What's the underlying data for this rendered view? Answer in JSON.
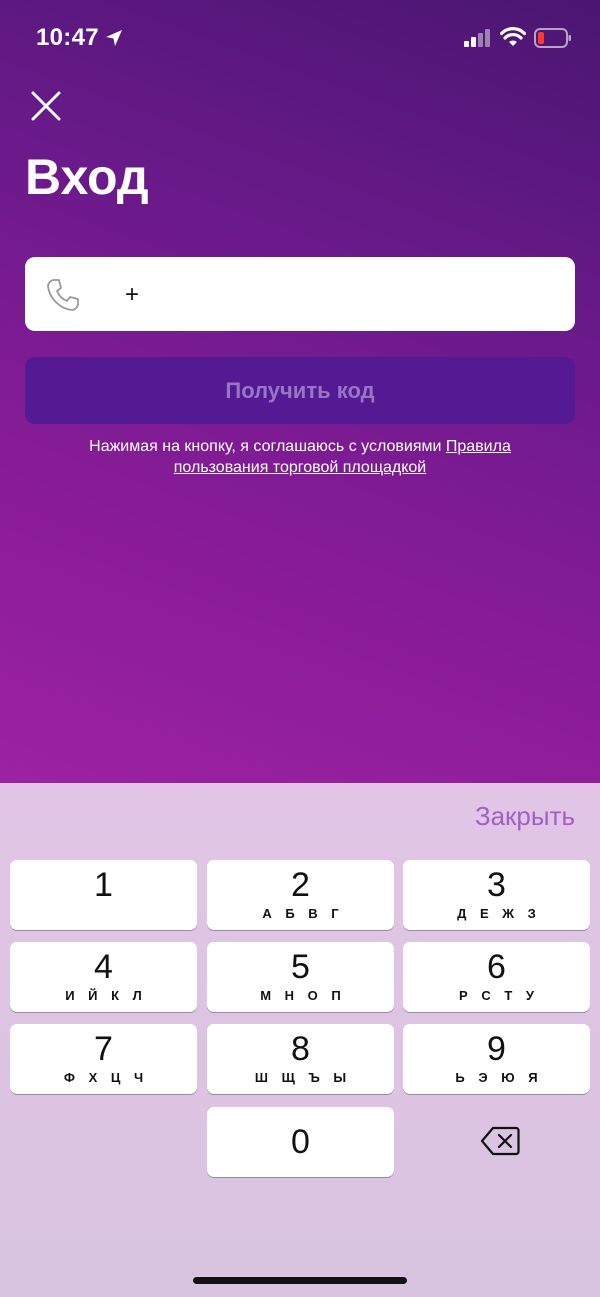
{
  "status_bar": {
    "time": "10:47"
  },
  "header": {
    "title": "Вход"
  },
  "phone_input": {
    "value": "+"
  },
  "get_code_button": {
    "label": "Получить код"
  },
  "terms": {
    "text": "Нажимая на кнопку, я соглашаюсь с условиями ",
    "link": "Правила пользования торговой площадкой"
  },
  "keyboard": {
    "close_label": "Закрыть",
    "keys": [
      {
        "digit": "1",
        "letters": ""
      },
      {
        "digit": "2",
        "letters": "А Б В Г"
      },
      {
        "digit": "3",
        "letters": "Д Е Ж З"
      },
      {
        "digit": "4",
        "letters": "И Й К Л"
      },
      {
        "digit": "5",
        "letters": "М Н О П"
      },
      {
        "digit": "6",
        "letters": "Р С Т У"
      },
      {
        "digit": "7",
        "letters": "Ф Х Ц Ч"
      },
      {
        "digit": "8",
        "letters": "Ш Щ Ъ Ы"
      },
      {
        "digit": "9",
        "letters": "Ь Э Ю Я"
      },
      {
        "digit": "0",
        "letters": ""
      }
    ]
  },
  "icons": [
    "location-arrow-icon",
    "signal-icon",
    "wifi-icon",
    "battery-icon",
    "close-icon",
    "phone-icon",
    "backspace-icon"
  ],
  "colors": {
    "accent": "#a15fc8",
    "button_bg": "#541a94",
    "button_text": "#9a75c4",
    "battery_low": "#ff3b30"
  }
}
